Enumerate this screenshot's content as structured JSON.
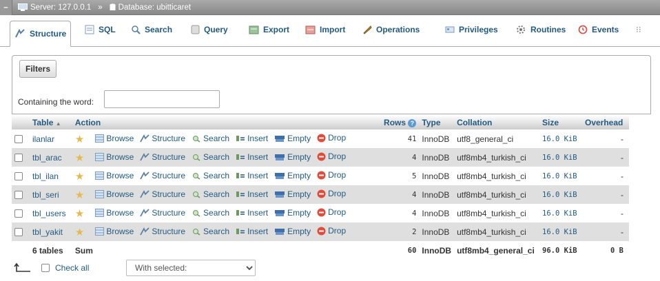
{
  "breadcrumb": {
    "server_label": "Server: 127.0.0.1",
    "separator": "»",
    "database_label": "Database: ubitticaret"
  },
  "tabs": [
    {
      "label": "Structure",
      "icon": "structure-icon"
    },
    {
      "label": "SQL",
      "icon": "sql-icon"
    },
    {
      "label": "Search",
      "icon": "search-icon"
    },
    {
      "label": "Query",
      "icon": "query-icon"
    },
    {
      "label": "Export",
      "icon": "export-icon"
    },
    {
      "label": "Import",
      "icon": "import-icon"
    },
    {
      "label": "Operations",
      "icon": "operations-icon"
    },
    {
      "label": "Privileges",
      "icon": "privileges-icon"
    },
    {
      "label": "Routines",
      "icon": "routines-icon"
    },
    {
      "label": "Events",
      "icon": "events-icon"
    }
  ],
  "filters": {
    "legend": "Filters",
    "containing_label": "Containing the word:",
    "input_value": ""
  },
  "table": {
    "headers": {
      "table": "Table",
      "action": "Action",
      "rows": "Rows",
      "type": "Type",
      "collation": "Collation",
      "size": "Size",
      "overhead": "Overhead"
    },
    "actions": [
      "Browse",
      "Structure",
      "Search",
      "Insert",
      "Empty",
      "Drop"
    ],
    "rows": [
      {
        "name": "ilanlar",
        "rows": "41",
        "type": "InnoDB",
        "collation": "utf8_general_ci",
        "size": "16.0 KiB",
        "overhead": "-"
      },
      {
        "name": "tbl_arac",
        "rows": "4",
        "type": "InnoDB",
        "collation": "utf8mb4_turkish_ci",
        "size": "16.0 KiB",
        "overhead": "-"
      },
      {
        "name": "tbl_ilan",
        "rows": "5",
        "type": "InnoDB",
        "collation": "utf8mb4_turkish_ci",
        "size": "16.0 KiB",
        "overhead": "-"
      },
      {
        "name": "tbl_seri",
        "rows": "4",
        "type": "InnoDB",
        "collation": "utf8mb4_turkish_ci",
        "size": "16.0 KiB",
        "overhead": "-"
      },
      {
        "name": "tbl_users",
        "rows": "4",
        "type": "InnoDB",
        "collation": "utf8mb4_turkish_ci",
        "size": "16.0 KiB",
        "overhead": "-"
      },
      {
        "name": "tbl_yakit",
        "rows": "2",
        "type": "InnoDB",
        "collation": "utf8mb4_turkish_ci",
        "size": "16.0 KiB",
        "overhead": "-"
      }
    ],
    "summary": {
      "tables": "6 tables",
      "sum": "Sum",
      "rows": "60",
      "type": "InnoDB",
      "collation": "utf8mb4_general_ci",
      "size": "96.0 KiB",
      "overhead": "0 B"
    }
  },
  "bottom": {
    "check_all_label": "Check all",
    "with_selected": "With selected:"
  },
  "colors": {
    "link": "#235a81",
    "row_alt": "#dfdfdf",
    "drop": "#e04c3c",
    "star": "#e5b94f"
  }
}
